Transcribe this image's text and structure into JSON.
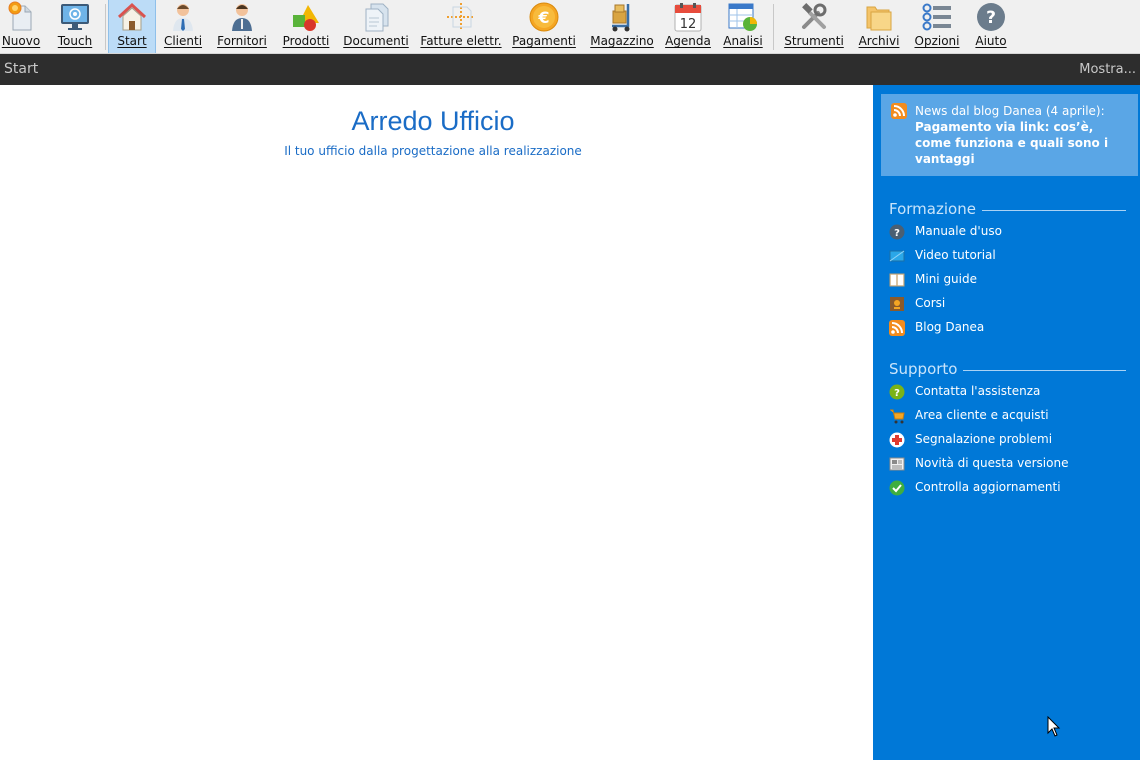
{
  "toolbar": {
    "buttons": [
      {
        "label": "Nuovo",
        "icon": "new-document-icon"
      },
      {
        "label": "Touch",
        "icon": "touch-monitor-icon"
      },
      {
        "label": "Start",
        "icon": "home-icon",
        "active": true
      },
      {
        "label": "Clienti",
        "icon": "client-person-icon"
      },
      {
        "label": "Fornitori",
        "icon": "supplier-person-icon"
      },
      {
        "label": "Prodotti",
        "icon": "products-shapes-icon"
      },
      {
        "label": "Documenti",
        "icon": "documents-icon"
      },
      {
        "label": "Fatture elettr.",
        "icon": "electronic-invoice-icon"
      },
      {
        "label": "Pagamenti",
        "icon": "euro-coin-icon"
      },
      {
        "label": "Magazzino",
        "icon": "warehouse-trolley-icon"
      },
      {
        "label": "Agenda",
        "icon": "calendar-icon",
        "day": "12"
      },
      {
        "label": "Analisi",
        "icon": "analysis-chart-icon"
      },
      {
        "label": "Strumenti",
        "icon": "tools-icon"
      },
      {
        "label": "Archivi",
        "icon": "folders-icon"
      },
      {
        "label": "Opzioni",
        "icon": "options-list-icon"
      },
      {
        "label": "Aiuto",
        "icon": "help-question-icon"
      }
    ]
  },
  "breadcrumb": {
    "title": "Start",
    "show_menu": "Mostra..."
  },
  "main": {
    "company_name": "Arredo Ufficio",
    "tagline": "Il tuo ufficio dalla progettazione alla realizzazione"
  },
  "sidepanel": {
    "news": {
      "heading": "News dal blog Danea (4 aprile):",
      "title": "Pagamento via link: cos’è, come funziona e quali sono i vantaggi",
      "icon": "rss-icon"
    },
    "sections": [
      {
        "title": "Formazione",
        "items": [
          {
            "label": "Manuale d'uso",
            "icon": "help-circle-icon"
          },
          {
            "label": "Video tutorial",
            "icon": "video-screen-icon"
          },
          {
            "label": "Mini guide",
            "icon": "book-icon"
          },
          {
            "label": "Corsi",
            "icon": "course-badge-icon"
          },
          {
            "label": "Blog Danea",
            "icon": "rss-icon"
          }
        ]
      },
      {
        "title": "Supporto",
        "items": [
          {
            "label": "Contatta l'assistenza",
            "icon": "support-question-icon"
          },
          {
            "label": "Area cliente e acquisti",
            "icon": "shopping-cart-icon"
          },
          {
            "label": "Segnalazione problemi",
            "icon": "red-cross-icon"
          },
          {
            "label": "Novità di questa versione",
            "icon": "news-sheet-icon"
          },
          {
            "label": "Controlla aggiornamenti",
            "icon": "green-check-icon"
          }
        ]
      }
    ]
  },
  "colors": {
    "accent": "#1a6cc6",
    "panel": "#0078d7",
    "news_box": "#5aa6e6",
    "crumb_bar": "#2d2d2d",
    "active_tab": "#bcdcf7"
  }
}
